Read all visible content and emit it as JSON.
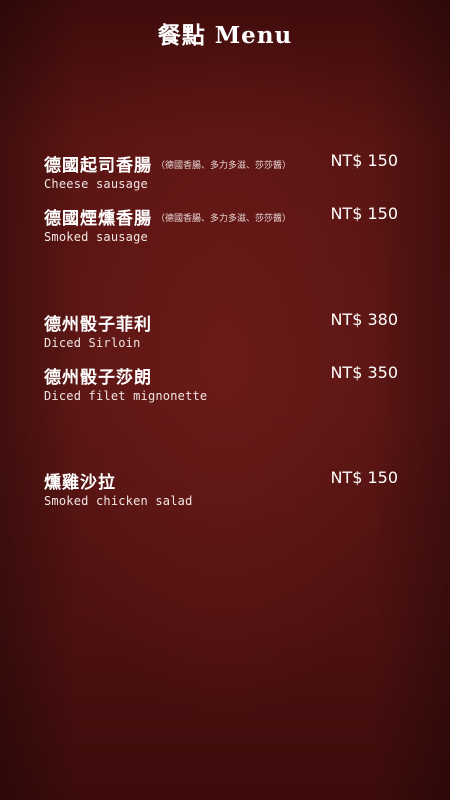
{
  "title": "餐點 Menu",
  "items": [
    {
      "name": "德國起司香腸",
      "note": "（德國香腸、多力多滋、莎莎醬）",
      "english": "Cheese sausage",
      "price": "NT$ 150"
    },
    {
      "name": "德國煙燻香腸",
      "note": "（德國香腸、多力多滋、莎莎醬）",
      "english": "Smoked sausage",
      "price": "NT$ 150"
    },
    {
      "name": "德州骰子菲利",
      "note": "",
      "english": "Diced Sirloin",
      "price": "NT$ 380"
    },
    {
      "name": "德州骰子莎朗",
      "note": "",
      "english": "Diced filet mignonette",
      "price": "NT$ 350"
    },
    {
      "name": "燻雞沙拉",
      "note": "",
      "english": "Smoked chicken salad",
      "price": "NT$ 150"
    }
  ]
}
